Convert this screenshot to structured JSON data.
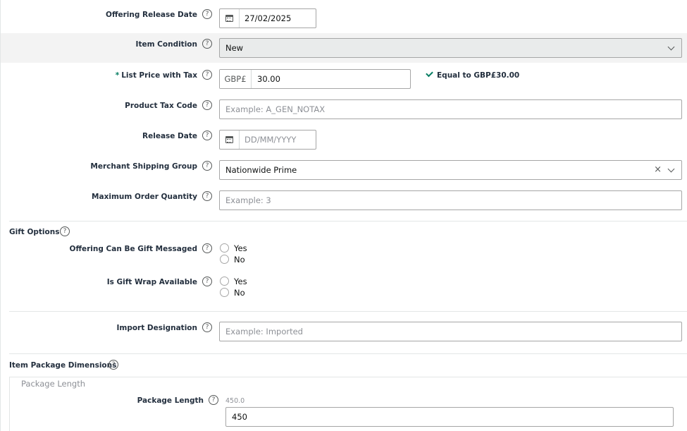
{
  "form": {
    "offering_release_date": {
      "label": "Offering Release Date",
      "value": "27/02/2025"
    },
    "item_condition": {
      "label": "Item Condition",
      "value": "New"
    },
    "list_price": {
      "required_marker": "*",
      "label": "List Price with Tax",
      "currency": "GBP£",
      "value": "30.00",
      "validation": "Equal to GBP£30.00"
    },
    "product_tax_code": {
      "label": "Product Tax Code",
      "placeholder": "Example: A_GEN_NOTAX"
    },
    "release_date": {
      "label": "Release Date",
      "placeholder": "DD/MM/YYYY"
    },
    "merchant_shipping_group": {
      "label": "Merchant Shipping Group",
      "value": "Nationwide Prime"
    },
    "max_order_quantity": {
      "label": "Maximum Order Quantity",
      "placeholder": "Example: 3"
    },
    "gift_options": {
      "title": "Gift Options",
      "gift_messaged": {
        "label": "Offering Can Be Gift Messaged",
        "options": [
          "Yes",
          "No"
        ]
      },
      "gift_wrap": {
        "label": "Is Gift Wrap Available",
        "options": [
          "Yes",
          "No"
        ]
      }
    },
    "import_designation": {
      "label": "Import Designation",
      "placeholder": "Example: Imported"
    },
    "item_package_dimensions": {
      "title": "Item Package Dimensions",
      "group_title": "Package Length",
      "package_length": {
        "label": "Package Length",
        "hint": "450.0",
        "value": "450"
      }
    }
  },
  "help_glyph": "?",
  "colors": {
    "accent_green": "#067d62",
    "label": "#232f3e",
    "border": "#a6a6a6",
    "shaded_row": "#f3f3f3"
  }
}
